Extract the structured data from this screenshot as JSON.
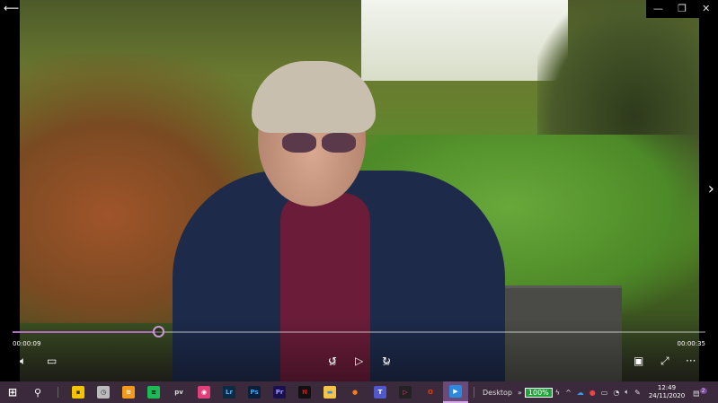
{
  "window": {
    "back_icon": "back-arrow-icon",
    "minimize": "—",
    "restore": "❐",
    "close": "✕"
  },
  "player": {
    "current_time": "00:00:09",
    "total_time": "00:00:35",
    "progress": 0.21,
    "accent": "#b26bc0",
    "skip_back_label": "10",
    "skip_forward_label": "30"
  },
  "taskbar": {
    "apps": [
      {
        "name": "sticky-notes",
        "glyph": "▪",
        "bg": "#f5c400",
        "fg": "#333"
      },
      {
        "name": "clock",
        "glyph": "◷",
        "bg": "#bbb",
        "fg": "#222"
      },
      {
        "name": "audible",
        "glyph": "≋",
        "bg": "#f39a1e",
        "fg": "#fff"
      },
      {
        "name": "spotify",
        "glyph": "≡",
        "bg": "#1db954",
        "fg": "#000"
      },
      {
        "name": "prime-video",
        "glyph": "pv",
        "bg": "transparent",
        "fg": "#ddd"
      },
      {
        "name": "photos-editor",
        "glyph": "◉",
        "bg": "#e0407a",
        "fg": "#fff"
      },
      {
        "name": "lightroom",
        "glyph": "Lr",
        "bg": "#0b2a44",
        "fg": "#58b0f0"
      },
      {
        "name": "photoshop",
        "glyph": "Ps",
        "bg": "#0a1f3a",
        "fg": "#31a8ff"
      },
      {
        "name": "premiere",
        "glyph": "Pr",
        "bg": "#1a1050",
        "fg": "#9999ff"
      },
      {
        "name": "netflix",
        "glyph": "N",
        "bg": "#111",
        "fg": "#e50914"
      },
      {
        "name": "file-explorer",
        "glyph": "▬",
        "bg": "#f3c34a",
        "fg": "#3a8ad8"
      },
      {
        "name": "firefox",
        "glyph": "●",
        "bg": "transparent",
        "fg": "#ff7a1a"
      },
      {
        "name": "teams",
        "glyph": "T",
        "bg": "#5059c9",
        "fg": "#fff"
      },
      {
        "name": "video-editor",
        "glyph": "▷",
        "bg": "#222",
        "fg": "#e0407a"
      },
      {
        "name": "office",
        "glyph": "O",
        "bg": "transparent",
        "fg": "#eb3c00"
      },
      {
        "name": "movies-tv",
        "glyph": "▶",
        "bg": "#2a8ae0",
        "fg": "#fff"
      }
    ],
    "desktop_label": "Desktop",
    "overflow": "»",
    "battery": "100%",
    "time": "12:49",
    "date": "24/11/2020",
    "notifications": "2"
  }
}
